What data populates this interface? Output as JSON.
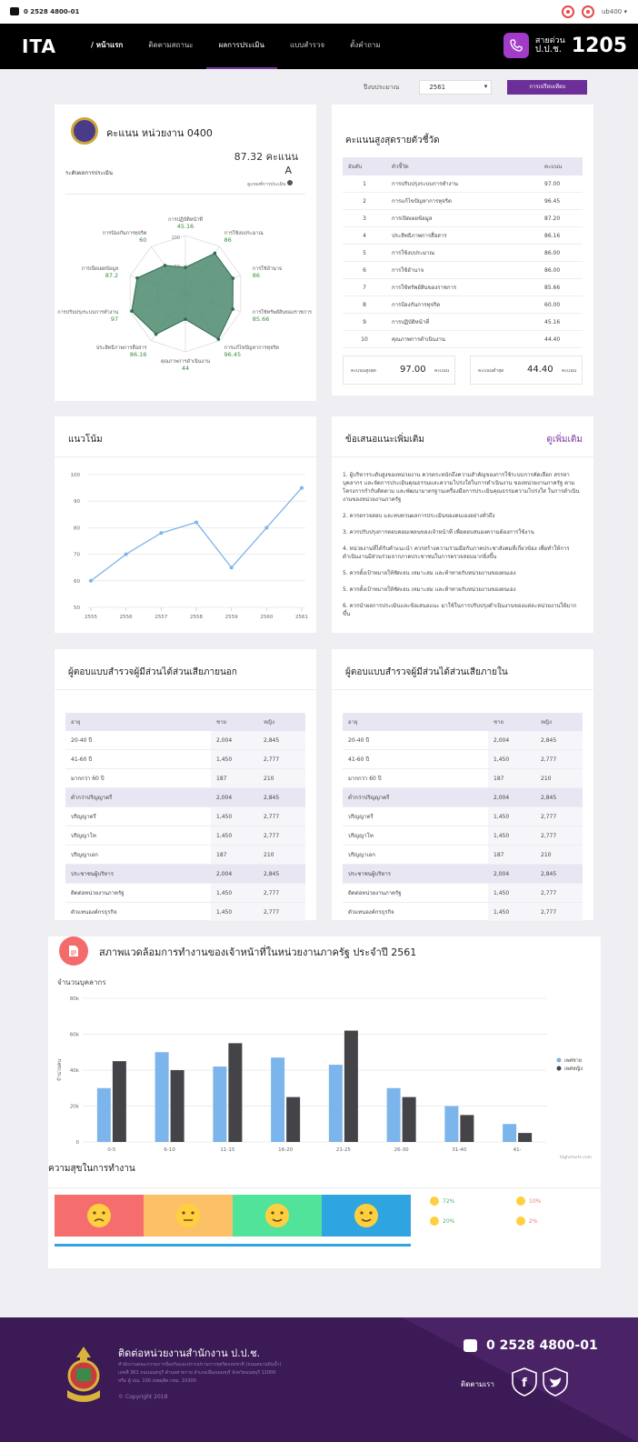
{
  "topbar": {
    "phone": "0 2528 4800-01",
    "user": "ub400"
  },
  "nav": {
    "logo": "ITA",
    "home": "หน้าแรก",
    "items": [
      "ติดตามสถานะ",
      "ผลการประเมิน",
      "แบบสำรวจ",
      "ตั้งคำถาม"
    ],
    "hotline_label_1": "สายด่วน",
    "hotline_label_2": "ป.ป.ช.",
    "hotline_number": "1205"
  },
  "filter": {
    "label": "ปีงบประมาณ",
    "year": "2561",
    "button": "การเปรียบเทียบ"
  },
  "score_card": {
    "title": "คะแนน หน่วยงาน 0400",
    "score": "87.32 คะแนน",
    "level_label": "ระดับผลการประเมิน",
    "grade": "A",
    "grade_note": "ดูเกณฑ์การประเมิน"
  },
  "radar": {
    "axes": [
      {
        "name": "การปฏิบัติหน้าที่",
        "value": "45.16",
        "v": 45.16
      },
      {
        "name": "การใช้งบประมาณ",
        "value": "86",
        "v": 86
      },
      {
        "name": "การใช้อำนาจ",
        "value": "86",
        "v": 86
      },
      {
        "name": "การใช้ทรัพย์สินของราชการ",
        "value": "85.66",
        "v": 85.66
      },
      {
        "name": "การแก้ไขปัญหาการทุจริต",
        "value": "96.45",
        "v": 96.45
      },
      {
        "name": "คุณภาพการดำเนินงาน",
        "value": "44",
        "v": 44
      },
      {
        "name": "ประสิทธิภาพการสื่อสาร",
        "value": "86.16",
        "v": 86.16
      },
      {
        "name": "การปรับปรุงระบบการทำงาน",
        "value": "97",
        "v": 97
      },
      {
        "name": "การเปิดเผยข้อมูล",
        "value": "87.2",
        "v": 87.2
      },
      {
        "name": "การป้องกันการทุจริต",
        "value": "60",
        "v": 60
      }
    ],
    "ticks": [
      "100",
      "50"
    ]
  },
  "top_scores": {
    "title": "คะแนนสูงสุดรายตัวชี้วัด",
    "headers": [
      "อันดับ",
      "ตัวชี้วัด",
      "คะแนน"
    ],
    "rows": [
      [
        "1",
        "การปรับปรุงระบบการทำงาน",
        "97.00"
      ],
      [
        "2",
        "การแก้ไขปัญหาการทุจริต",
        "96.45"
      ],
      [
        "3",
        "การเปิดเผยข้อมูล",
        "87.20"
      ],
      [
        "4",
        "ประสิทธิภาพการสื่อสาร",
        "86.16"
      ],
      [
        "5",
        "การใช้งบประมาณ",
        "86.00"
      ],
      [
        "6",
        "การใช้อำนาจ",
        "86.00"
      ],
      [
        "7",
        "การใช้ทรัพย์สินของราชการ",
        "85.66"
      ],
      [
        "8",
        "การป้องกันการทุจริต",
        "60.00"
      ],
      [
        "9",
        "การปฏิบัติหน้าที่",
        "45.16"
      ],
      [
        "10",
        "คุณภาพการดำเนินงาน",
        "44.40"
      ]
    ],
    "max_label": "คะแนนสูงสุด",
    "max_value": "97.00",
    "min_label": "คะแนนต่ำสุด",
    "min_value": "44.40",
    "unit": "คะแนน"
  },
  "trend": {
    "title": "แนวโน้ม"
  },
  "suggestions": {
    "title": "ข้อเสนอแนะเพิ่มเติม",
    "more": "ดูเพิ่มเติม",
    "items": [
      "1. ผู้บริหารระดับสูงของหน่วยงาน ควรตระหนักถึงความสำคัญของการใช้ระบบการคัดเลือก สรรหาบุคลากร และจัดการประเมินคุณธรรมและความโปร่งใสในการดำเนินงาน ของหน่วยงานภาครัฐ ตามโครงการกำกับติดตาม และพัฒนามาตรฐานเครื่องมือการประเมินคุณธรรมความโปร่งใส ในการดำเนินงานของหน่วยงานภาครัฐ",
      "2. ควรตรวจสอบ และทบทวนผลการประเมินของตนเองอย่างทั่วถึง",
      "3. ควรปรับปรุงการตอบคอมเพลนของเจ้าหน้าที่ เพื่อตอบสนองความต้องการใช้งาน",
      "4. หน่วยงานที่ได้รับคำแนะนำ ควรสร้างความร่วมมือกับภาคประชาสังคมที่เกี่ยวข้อง เพื่อทำให้การดำเนินงานมีส่วนร่วมจากภาคประชาชนในการตรวจสอบมากยิ่งขึ้น",
      "5. ควรตั้งเป้าหมายให้ชัดเจน เหมาะสม และท้าทายกับหน่วยงานของตนเอง",
      "5. ควรตั้งเป้าหมายให้ชัดเจน เหมาะสม และท้าทายกับหน่วยงานของตนเอง",
      "6. ควรนำผลการประเมินและข้อเสนอแนะ มาใช้ในการปรับปรุงดำเนินงานของแต่ละหน่วยงานให้มากขึ้น"
    ]
  },
  "external": {
    "title": "ผู้ตอบแบบสำรวจผู้มีส่วนได้ส่วนเสียภายนอก"
  },
  "internal": {
    "title": "ผู้ตอบแบบสำรวจผู้มีส่วนได้ส่วนเสียภายใน"
  },
  "demographics": {
    "headers": [
      "อายุ",
      "ชาย",
      "หญิง"
    ],
    "rows": [
      {
        "label": "20-40 ปี",
        "m": "2,004",
        "f": "2,845",
        "group": false
      },
      {
        "label": "41-60 ปี",
        "m": "1,450",
        "f": "2,777",
        "group": false
      },
      {
        "label": "มากกว่า 60 ปี",
        "m": "187",
        "f": "210",
        "group": false
      },
      {
        "label": "ต่ำกว่าปริญญาตรี",
        "m": "2,004",
        "f": "2,845",
        "group": true
      },
      {
        "label": "ปริญญาตรี",
        "m": "1,450",
        "f": "2,777",
        "group": false
      },
      {
        "label": "ปริญญาโท",
        "m": "1,450",
        "f": "2,777",
        "group": false
      },
      {
        "label": "ปริญญาเอก",
        "m": "187",
        "f": "210",
        "group": false
      },
      {
        "label": "ประชาชนผู้บริหาร",
        "m": "2,004",
        "f": "2,845",
        "group": true
      },
      {
        "label": "ติดต่อหน่วยงานภาครัฐ",
        "m": "1,450",
        "f": "2,777",
        "group": false
      },
      {
        "label": "ตัวแทนองค์กรธุรกิจ",
        "m": "1,450",
        "f": "2,777",
        "group": false
      }
    ]
  },
  "environment": {
    "title": "สภาพแวดล้อมการทำงานของเจ้าหน้าที่ในหน่วยงานภาครัฐ ประจำปี 2561",
    "subtitle": "จำนวนบุคลากร",
    "credit": "Highcharts.com"
  },
  "happiness": {
    "title": "ความสุขในการทำงาน",
    "colors": [
      "#f56d6d",
      "#fcc066",
      "#52e39a",
      "#2ea4e0"
    ],
    "stats": [
      {
        "value": "72%",
        "color": "#4bb86a"
      },
      {
        "value": "10%",
        "color": "#f27b7b"
      },
      {
        "value": "20%",
        "color": "#4bb86a"
      },
      {
        "value": "2%",
        "color": "#f27b7b"
      }
    ]
  },
  "footer": {
    "title": "ติดต่อหน่วยงานสำนักงาน ป.ป.ช.",
    "addr1": "สำนักงานคณะกรรมการป้องกันและปราบปรามการทุจริตแห่งชาติ (ถนนสนามบินน้ำ)",
    "addr2": "เลขที่ 361 ถนนนนทบุรี ตำบลท่าทราย อำเภอเมืองนนทบุรี จังหวัดนนทบุรี 11000",
    "addr3": "หรือ ตู้ ปณ. 100 เขตดุสิต กทม. 10300",
    "copyright": "© Copyright 2018",
    "phone": "0 2528 4800-01",
    "follow": "ติดตามเรา"
  },
  "chart_data": [
    {
      "type": "line",
      "title": "แนวโน้ม",
      "x": [
        "2555",
        "2556",
        "2557",
        "2558",
        "2559",
        "2560",
        "2561"
      ],
      "values": [
        60,
        70,
        78,
        82,
        65,
        80,
        95
      ],
      "ylim": [
        50,
        100
      ],
      "yticks": [
        "50",
        "60",
        "70",
        "80",
        "90",
        "100"
      ],
      "color": "#7cb5ec"
    },
    {
      "type": "bar",
      "title": "สภาพแวดล้อมการทำงานของเจ้าหน้าที่ในหน่วยงานภาครัฐ ประจำปี 2561",
      "ylabel": "จำนวนคน",
      "categories": [
        "0-5",
        "6-10",
        "11-15",
        "16-20",
        "21-25",
        "26-30",
        "31-40",
        "41-"
      ],
      "ylim": [
        0,
        80000
      ],
      "yticks": [
        "0",
        "20k",
        "40k",
        "60k",
        "80k"
      ],
      "series": [
        {
          "name": "เพศชาย",
          "color": "#7cb5ec",
          "values": [
            30000,
            50000,
            42000,
            47000,
            43000,
            30000,
            20000,
            10000
          ]
        },
        {
          "name": "เพศหญิง",
          "color": "#434348",
          "values": [
            45000,
            40000,
            55000,
            25000,
            62000,
            25000,
            15000,
            5000
          ]
        }
      ]
    }
  ]
}
